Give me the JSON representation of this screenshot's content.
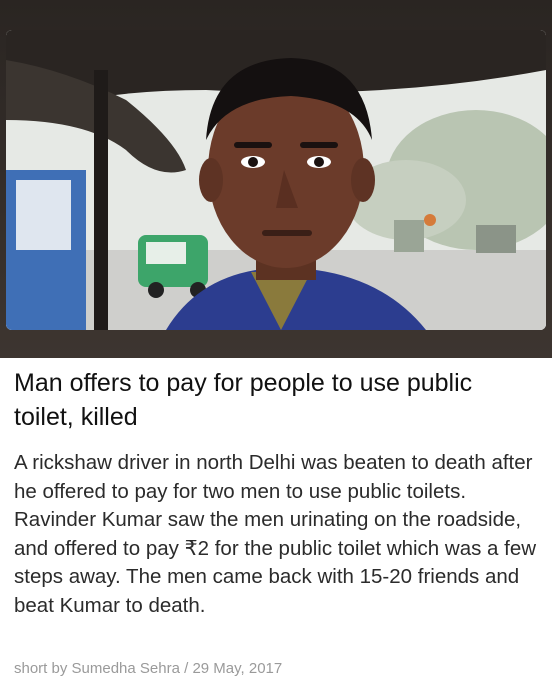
{
  "article": {
    "image": {
      "description_icon": "news-photo",
      "colors": {
        "frame": "#2a2522",
        "sky": "#eef0ee",
        "skin": "#6b3b2a",
        "hair": "#141010",
        "shirt": "#2c3d8f"
      }
    },
    "headline": "Man offers to pay for people to use public toilet, killed",
    "summary": "A rickshaw driver in north Delhi was beaten to death after he offered to pay for two men to use public toilets. Ravinder Kumar saw the men urinating on the roadside, and offered to pay ₹2 for the public toilet which was a few steps away. The men came back with 15-20 friends and beat Kumar to death.",
    "byline": {
      "prefix": "short by",
      "author": "Sumedha Sehra",
      "separator": "/",
      "date": "29 May, 2017"
    }
  }
}
